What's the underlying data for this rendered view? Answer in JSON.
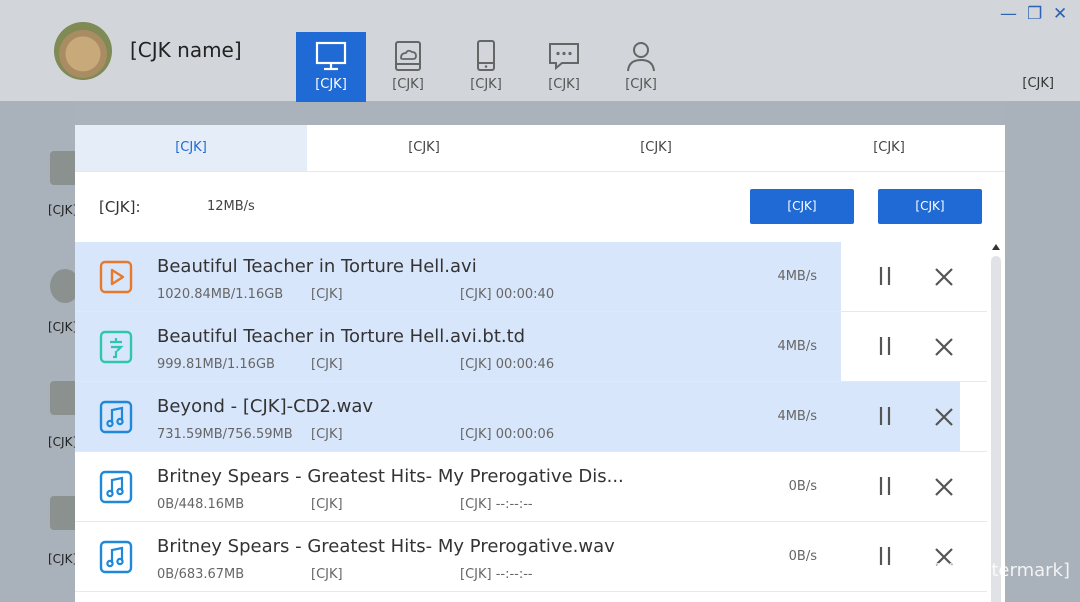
{
  "header": {
    "username": "[CJK name]",
    "nav": [
      {
        "label": "[CJK]",
        "icon": "desktop-icon",
        "active": true
      },
      {
        "label": "[CJK]",
        "icon": "cloud-drive-icon",
        "active": false
      },
      {
        "label": "[CJK]",
        "icon": "phone-backup-icon",
        "active": false
      },
      {
        "label": "[CJK]",
        "icon": "chat-icon",
        "active": false
      },
      {
        "label": "[CJK]",
        "icon": "user-icon",
        "active": false
      }
    ],
    "lan_link": "[CJK]",
    "window_controls": {
      "minimize": "—",
      "restore": "❐",
      "close": "✕"
    }
  },
  "sidebar": {
    "items": [
      "[CJK]",
      "[CJK]",
      "[CJK]",
      "[CJK]"
    ]
  },
  "modal": {
    "tabs": [
      "[CJK]",
      "[CJK]",
      "[CJK]",
      "[CJK]"
    ],
    "speed_label": "[CJK]:",
    "speed_value": "12MB/s",
    "pause_all_label": "[CJK]",
    "cancel_all_label": "[CJK]",
    "rows": [
      {
        "name": "Beautiful Teacher in Torture Hell.avi",
        "size": "1020.84MB/1.16GB",
        "status": "[CJK]",
        "time": "[CJK] 00:00:40",
        "rate": "4MB/s",
        "progress": 0.84,
        "icon": "video-file-icon",
        "color": "#e8792a"
      },
      {
        "name": "Beautiful Teacher in Torture Hell.avi.bt.td",
        "size": "999.81MB/1.16GB",
        "status": "[CJK]",
        "time": "[CJK] 00:00:46",
        "rate": "4MB/s",
        "progress": 0.84,
        "icon": "torrent-file-icon",
        "color": "#2ec6b0"
      },
      {
        "name": "Beyond - [CJK]-CD2.wav",
        "size": "731.59MB/756.59MB",
        "status": "[CJK]",
        "time": "[CJK] 00:00:06",
        "rate": "4MB/s",
        "progress": 0.97,
        "icon": "music-file-icon",
        "color": "#1f88d8"
      },
      {
        "name": "Britney Spears - Greatest Hits- My Prerogative Dis...",
        "size": "0B/448.16MB",
        "status": "[CJK]",
        "time": "[CJK] --:--:--",
        "rate": "0B/s",
        "progress": 0,
        "icon": "music-file-icon",
        "color": "#1f88d8"
      },
      {
        "name": "Britney Spears - Greatest Hits- My Prerogative.wav",
        "size": "0B/683.67MB",
        "status": "[CJK]",
        "time": "[CJK] --:--:--",
        "rate": "0B/s",
        "progress": 0,
        "icon": "music-file-icon",
        "color": "#1f88d8"
      }
    ]
  },
  "watermark": "[CJK watermark]",
  "colors": {
    "accent": "#1f6ad4",
    "progress": "#d8e6fb",
    "active_tab_bg": "#e4edf8"
  }
}
